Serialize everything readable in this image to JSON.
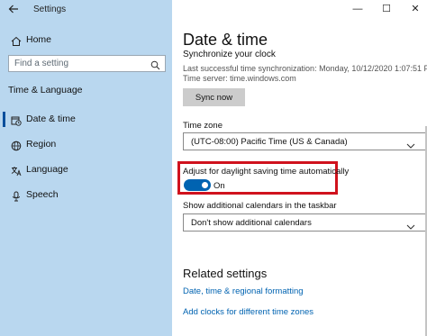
{
  "window": {
    "app_title": "Settings",
    "controls": {
      "minimize": "—",
      "maximize": "☐",
      "close": "✕"
    }
  },
  "sidebar": {
    "home_label": "Home",
    "search_placeholder": "Find a setting",
    "section_heading": "Time & Language",
    "items": [
      {
        "label": "Date & time",
        "icon": "calendar-clock-icon",
        "active": true
      },
      {
        "label": "Region",
        "icon": "globe-icon",
        "active": false
      },
      {
        "label": "Language",
        "icon": "language-icon",
        "active": false
      },
      {
        "label": "Speech",
        "icon": "microphone-icon",
        "active": false
      }
    ]
  },
  "main": {
    "title": "Date & time",
    "sync": {
      "heading": "Synchronize your clock",
      "last_sync": "Last successful time synchronization: Monday, 10/12/2020 1:07:51 PM",
      "time_server": "Time server: time.windows.com",
      "button_label": "Sync now"
    },
    "time_zone": {
      "label": "Time zone",
      "value": "(UTC-08:00) Pacific Time (US & Canada)"
    },
    "dst": {
      "label": "Adjust for daylight saving time automatically",
      "state_label": "On",
      "enabled": true
    },
    "calendars": {
      "label": "Show additional calendars in the taskbar",
      "value": "Don't show additional calendars"
    },
    "related": {
      "heading": "Related settings",
      "links": [
        "Date, time & regional formatting",
        "Add clocks for different time zones"
      ]
    }
  },
  "colors": {
    "sidebar_bg": "#b9d7ef",
    "accent": "#0063b1",
    "highlight": "#d0121d"
  }
}
